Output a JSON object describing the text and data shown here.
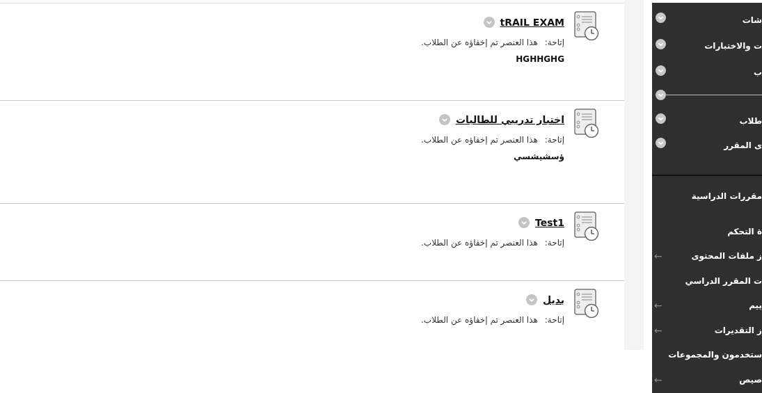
{
  "content_items": [
    {
      "title": "tRAIL EXAM",
      "availability_label": "إتاحة:",
      "availability": "هذا العنصر تم إخفاؤه عن الطلاب.",
      "description": "HGHHGHG"
    },
    {
      "title": "اختبار تدريبي للطالبات",
      "availability_label": "إتاحة:",
      "availability": "هذا العنصر تم إخفاؤه عن الطلاب.",
      "description": "ؤسشيشسي"
    },
    {
      "title": "Test1",
      "availability_label": "إتاحة:",
      "availability": "هذا العنصر تم إخفاؤه عن الطلاب."
    },
    {
      "title": "بديل",
      "availability_label": "إتاحة:",
      "availability": "هذا العنصر تم إخفاؤه عن الطلاب."
    }
  ],
  "sidebar": {
    "top_items": [
      {
        "kind": "menu",
        "label": "شات"
      },
      {
        "kind": "menu",
        "label": "ت والاختبارات"
      },
      {
        "kind": "menu",
        "label": "ب"
      },
      {
        "kind": "divider"
      },
      {
        "kind": "menu",
        "label": "طلاب"
      },
      {
        "kind": "menu",
        "label": "ى المقرر"
      }
    ],
    "bottom_items": [
      {
        "label": "مقررات الدراسية"
      },
      {
        "label": "ة التحكم"
      },
      {
        "label": "ز ملفات المحتوى",
        "arrow": "←"
      },
      {
        "label": "ت المقرر الدراسي"
      },
      {
        "label": "ييم",
        "arrow": "←"
      },
      {
        "label": "ز التقديرات",
        "arrow": "←"
      },
      {
        "label": "ستخدمون والمجموعات"
      },
      {
        "label": "صيص",
        "arrow": "←"
      }
    ]
  }
}
